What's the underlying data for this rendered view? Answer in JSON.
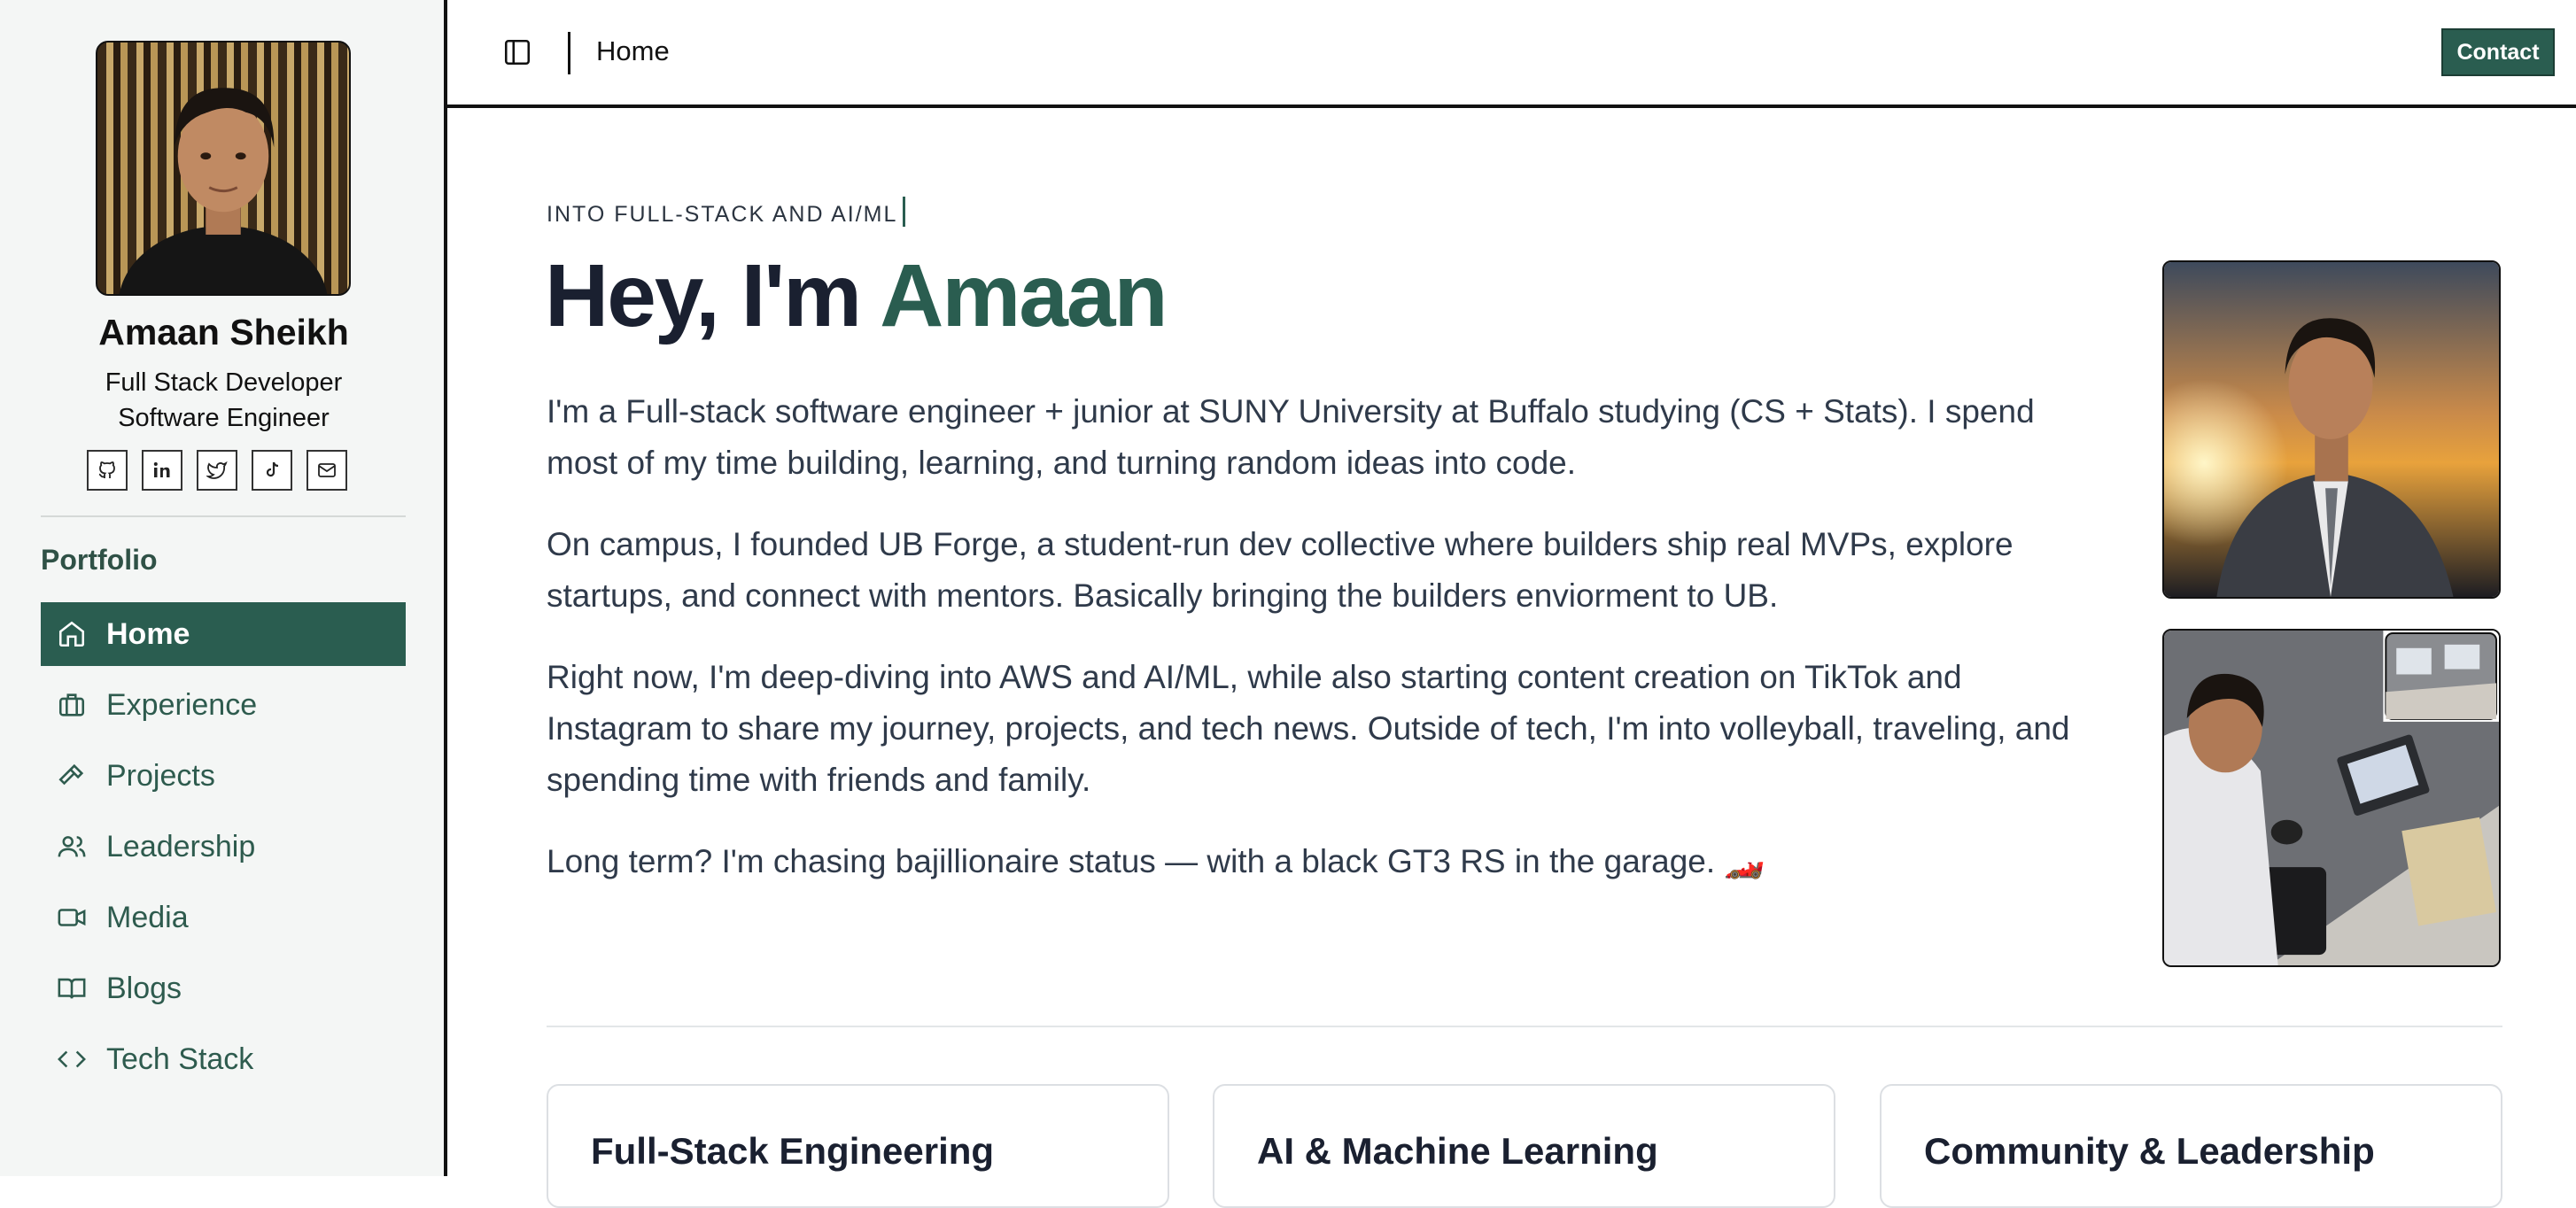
{
  "sidebar": {
    "profile": {
      "name": "Amaan Sheikh",
      "roles": [
        "Full Stack Developer",
        "Software Engineer"
      ]
    },
    "social": [
      {
        "icon": "github-icon"
      },
      {
        "icon": "linkedin-icon"
      },
      {
        "icon": "twitter-icon"
      },
      {
        "icon": "tiktok-icon"
      },
      {
        "icon": "mail-icon"
      }
    ],
    "section_label": "Portfolio",
    "nav": [
      {
        "label": "Home",
        "icon": "home-icon",
        "active": true
      },
      {
        "label": "Experience",
        "icon": "briefcase-icon",
        "active": false
      },
      {
        "label": "Projects",
        "icon": "hammer-icon",
        "active": false
      },
      {
        "label": "Leadership",
        "icon": "users-icon",
        "active": false
      },
      {
        "label": "Media",
        "icon": "video-icon",
        "active": false
      },
      {
        "label": "Blogs",
        "icon": "book-icon",
        "active": false
      },
      {
        "label": "Tech Stack",
        "icon": "code-icon",
        "active": false
      }
    ]
  },
  "topbar": {
    "breadcrumb": "Home",
    "contact_label": "Contact"
  },
  "hero": {
    "eyebrow": "INTO FULL-STACK AND AI/ML",
    "title_prefix": "Hey, I'm ",
    "title_name": "Amaan",
    "paragraphs": [
      "I'm a Full-stack software engineer + junior at SUNY University at Buffalo studying (CS + Stats). I spend most of my time building, learning, and turning random ideas into code.",
      "On campus, I founded UB Forge, a student-run dev collective where builders ship real MVPs, explore startups, and connect with mentors. Basically bringing the builders enviorment to UB.",
      "Right now, I'm deep-diving into AWS and AI/ML, while also starting content creation on TikTok and Instagram to share my journey, projects, and tech news. Outside of tech, I'm into volleyball, traveling, and spending time with friends and family.",
      "Long term? I'm chasing bajillionaire status — with a black GT3 RS in the garage. 🏎️"
    ]
  },
  "cards": [
    {
      "title": "Full-Stack Engineering"
    },
    {
      "title": "AI & Machine Learning"
    },
    {
      "title": "Community & Leadership"
    }
  ],
  "colors": {
    "accent": "#2a5d50",
    "sidebar_bg": "#f4f6f5",
    "heading": "#1a2030"
  }
}
